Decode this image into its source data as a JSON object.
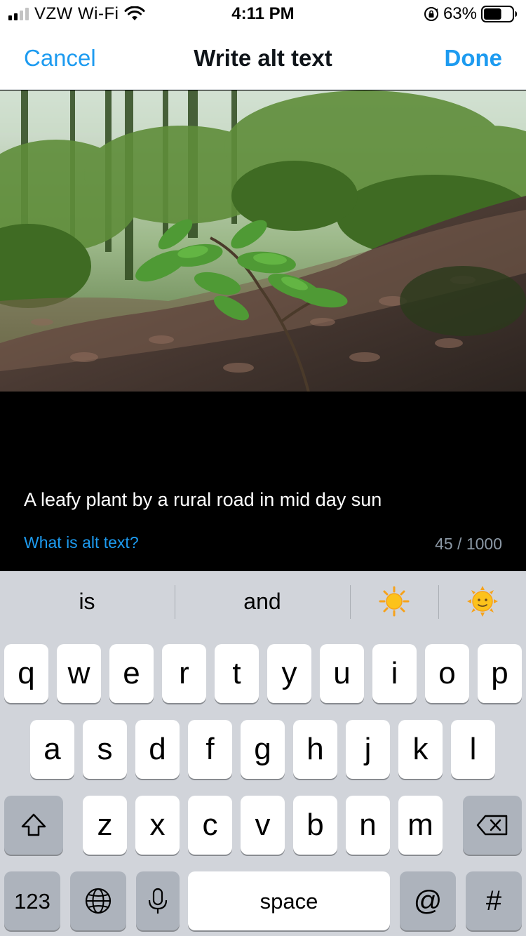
{
  "status_bar": {
    "carrier": "VZW Wi-Fi",
    "time": "4:11 PM",
    "battery_percent": "63%",
    "signal_bars_filled": 2,
    "signal_bars_total": 4,
    "battery_level": 0.63
  },
  "nav": {
    "cancel_label": "Cancel",
    "title": "Write alt text",
    "done_label": "Done"
  },
  "alt_text": {
    "value": "A leafy plant by a rural road in mid day sun",
    "help_link": "What is alt text?",
    "counter": "45 / 1000"
  },
  "keyboard": {
    "suggestions": [
      "is",
      "and"
    ],
    "suggestion_emojis": [
      "sun-icon",
      "sun-with-face-icon"
    ],
    "row1": [
      "q",
      "w",
      "e",
      "r",
      "t",
      "y",
      "u",
      "i",
      "o",
      "p"
    ],
    "row2": [
      "a",
      "s",
      "d",
      "f",
      "g",
      "h",
      "j",
      "k",
      "l"
    ],
    "row3": [
      "z",
      "x",
      "c",
      "v",
      "b",
      "n",
      "m"
    ],
    "numbers_label": "123",
    "space_label": "space",
    "at_label": "@",
    "hash_label": "#"
  },
  "colors": {
    "accent": "#1d9bf0",
    "keyboard_bg": "#d1d4da",
    "key_fn_bg": "#adb3bc",
    "counter": "#8b98a5"
  },
  "icons": [
    "wifi-icon",
    "orientation-lock-icon",
    "battery-icon",
    "shift-icon",
    "backspace-icon",
    "globe-icon",
    "microphone-icon"
  ]
}
